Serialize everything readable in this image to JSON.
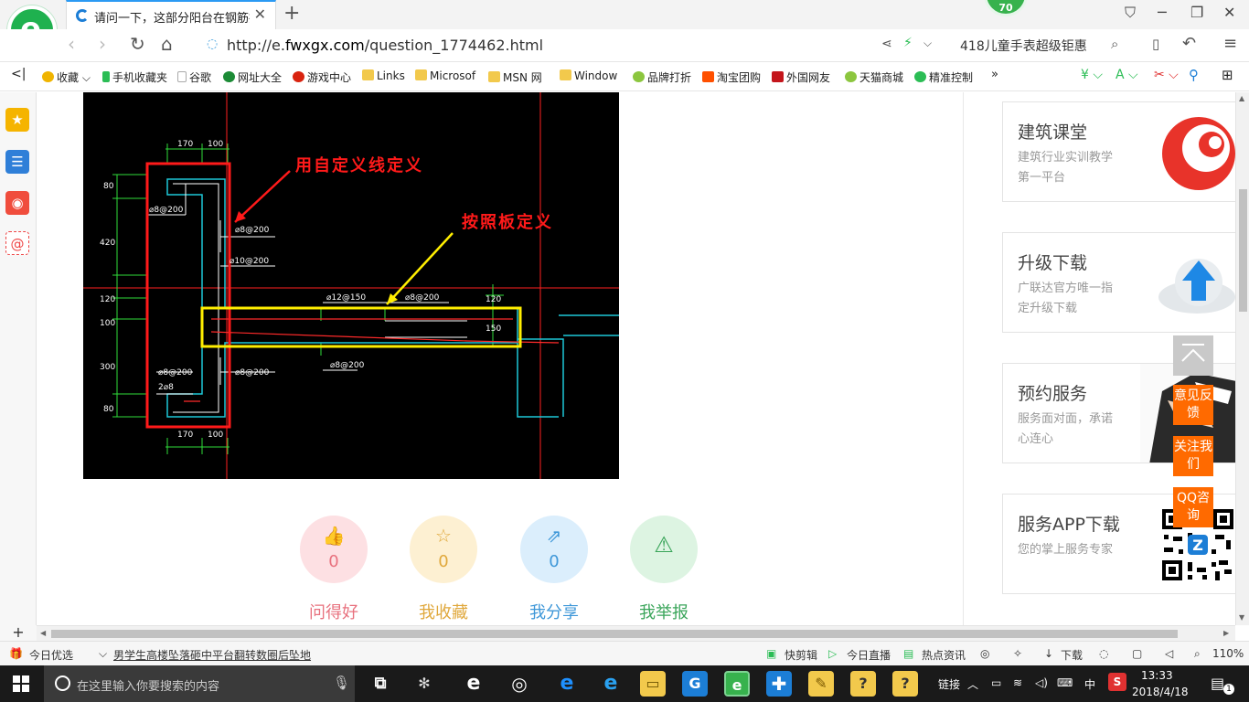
{
  "browser": {
    "tab_title": "请问一下，这部分阳台在钢筋抽样",
    "tab_close": "✕",
    "new_tab": "+",
    "badge_count": "70",
    "url_prefix": "http://e.",
    "url_domain": "fwxgx.com",
    "url_path": "/question_1774462.html",
    "search_promo": "418儿童手表超级钜惠",
    "bookmarks": [
      {
        "label": "收藏",
        "color": "#f0b400"
      },
      {
        "label": "手机收藏夹",
        "color": "#2bbd55"
      },
      {
        "label": "谷歌",
        "color": "#bbbbbb"
      },
      {
        "label": "网址大全",
        "color": "#1c8b36"
      },
      {
        "label": "游戏中心",
        "color": "#d9230f"
      },
      {
        "label": "Links",
        "color": "#f2c94c"
      },
      {
        "label": "Microsof",
        "color": "#f2c94c"
      },
      {
        "label": "MSN 网",
        "color": "#f2c94c"
      },
      {
        "label": "Window",
        "color": "#f2c94c"
      },
      {
        "label": "品牌打折",
        "color": "#8cc63f"
      },
      {
        "label": "淘宝团购",
        "color": "#ff5000"
      },
      {
        "label": "外国网友",
        "color": "#c4161c"
      },
      {
        "label": "天猫商城",
        "color": "#8cc63f"
      },
      {
        "label": "精准控制",
        "color": "#2bbd55"
      }
    ]
  },
  "cad": {
    "label_custom_line": "用自定义线定义",
    "label_slab": "按照板定义",
    "dims": {
      "top_170": "170",
      "top_100": "100",
      "bot_170": "170",
      "bot_100": "100",
      "left_80a": "80",
      "left_420": "420",
      "left_120": "120",
      "left_100": "100",
      "left_300": "300",
      "left_80b": "80",
      "r_120": "120",
      "r_150": "150",
      "rb1": "⌀8@200",
      "rb2": "⌀8@200",
      "rb3": "⌀10@200",
      "rb4": "⌀12@150",
      "rb5": "⌀8@200",
      "rb6": "⌀8@200",
      "rb7": "⌀8@200",
      "rb8": "2⌀8",
      "rb9": "⌀8@200"
    }
  },
  "actions": [
    {
      "label": "问得好",
      "count": "0",
      "icon": "👍",
      "bg": "#fde0e3",
      "fg": "#e8717e"
    },
    {
      "label": "我收藏",
      "count": "0",
      "icon": "☆",
      "bg": "#fdf0d2",
      "fg": "#e0a83c"
    },
    {
      "label": "我分享",
      "count": "0",
      "icon": "⇗",
      "bg": "#dbeefc",
      "fg": "#3e97d8"
    },
    {
      "label": "我举报",
      "count": "0",
      "icon": "⚠",
      "bg": "#ddf4e2",
      "fg": "#3aa55a"
    }
  ],
  "cards": [
    {
      "title": "建筑课堂",
      "desc": "建筑行业实训教学第一平台"
    },
    {
      "title": "升级下载",
      "desc": "广联达官方唯一指定升级下载"
    },
    {
      "title": "预约服务",
      "desc": "服务面对面，承诺心连心"
    },
    {
      "title": "服务APP下载",
      "desc": "您的掌上服务专家"
    }
  ],
  "float_buttons": [
    "意见反馈",
    "关注我们",
    "QQ咨询"
  ],
  "status": {
    "today": "今日优选",
    "news": "男学生高楼坠落砸中平台翻转数圈后坠地",
    "kuaijianji": "快剪辑",
    "live": "今日直播",
    "hot": "热点资讯",
    "download": "下载",
    "zoom": "110%"
  },
  "taskbar": {
    "search_placeholder": "在这里输入你要搜索的内容",
    "links": "链接",
    "ime": "中",
    "time": "13:33",
    "date": "2018/4/18",
    "notify_count": "1"
  }
}
